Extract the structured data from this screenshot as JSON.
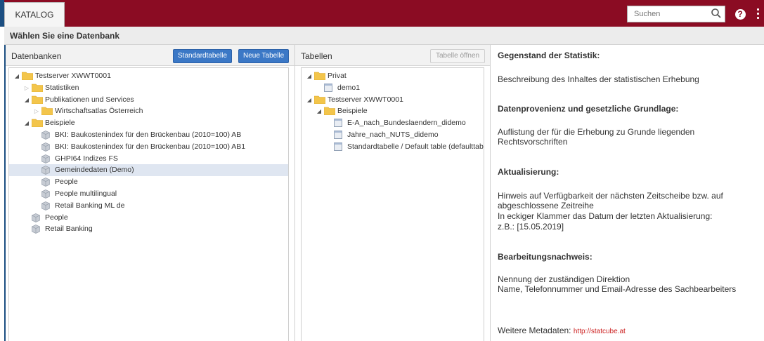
{
  "topbar": {
    "tab_label": "KATALOG",
    "search_placeholder": "Suchen",
    "help_label": "?",
    "brand_color": "#8b0c23"
  },
  "heading": "Wählen Sie eine Datenbank",
  "databases": {
    "title": "Datenbanken",
    "btn_standard": "Standardtabelle",
    "btn_new": "Neue Tabelle",
    "tree": [
      {
        "label": "Testserver XWWT0001",
        "icon": "folder-icon",
        "state": "open"
      },
      {
        "label": "Statistiken",
        "icon": "folder-icon",
        "state": "closed"
      },
      {
        "label": "Publikationen und Services",
        "icon": "folder-icon",
        "state": "open"
      },
      {
        "label": "Wirtschaftsatlas Österreich",
        "icon": "folder-icon",
        "state": "closed"
      },
      {
        "label": "Beispiele",
        "icon": "folder-icon",
        "state": "open"
      },
      {
        "label": "BKI: Baukostenindex für den Brückenbau (2010=100) AB",
        "icon": "cube-icon",
        "state": "leaf"
      },
      {
        "label": "BKI: Baukostenindex für den Brückenbau (2010=100) AB1",
        "icon": "cube-icon",
        "state": "leaf"
      },
      {
        "label": "GHPI64 Indizes FS",
        "icon": "cube-icon",
        "state": "leaf"
      },
      {
        "label": "Gemeindedaten (Demo)",
        "icon": "cube-icon",
        "state": "leaf",
        "selected": true
      },
      {
        "label": "People",
        "icon": "cube-icon",
        "state": "leaf"
      },
      {
        "label": "People multilingual",
        "icon": "cube-icon",
        "state": "leaf"
      },
      {
        "label": "Retail Banking ML de",
        "icon": "cube-icon",
        "state": "leaf"
      },
      {
        "label": "People",
        "icon": "cube-icon",
        "state": "leaf"
      },
      {
        "label": "Retail Banking",
        "icon": "cube-icon",
        "state": "leaf"
      }
    ]
  },
  "tables": {
    "title": "Tabellen",
    "btn_open": "Tabelle öffnen",
    "tree": [
      {
        "label": "Privat",
        "icon": "folder-icon",
        "state": "open"
      },
      {
        "label": "demo1",
        "icon": "table-icon",
        "state": "leaf"
      },
      {
        "label": "Testserver XWWT0001",
        "icon": "folder-icon",
        "state": "open"
      },
      {
        "label": "Beispiele",
        "icon": "folder-icon",
        "state": "open"
      },
      {
        "label": "E-A_nach_Bundeslaendern_didemo",
        "icon": "table-icon",
        "state": "leaf"
      },
      {
        "label": "Jahre_nach_NUTS_didemo",
        "icon": "table-icon",
        "state": "leaf"
      },
      {
        "label": "Standardtabelle / Default table (defaulttable)",
        "icon": "table-icon",
        "state": "leaf"
      }
    ]
  },
  "metadata": {
    "h_subject": "Gegenstand der Statistik:",
    "t_subject": "Beschreibung des Inhaltes der statistischen Erhebung",
    "h_provenance": "Datenprovenienz und gesetzliche Grundlage:",
    "t_provenance_1": "Auflistung der für die Erhebung zu Grunde liegenden",
    "t_provenance_2": "Rechtsvorschriften",
    "h_update": "Aktualisierung:",
    "t_update_1": "Hinweis auf Verfügbarkeit der nächsten Zeitscheibe bzw. auf",
    "t_update_2": "abgeschlossene Zeitreihe",
    "t_update_3": "In eckiger Klammer das Datum der letzten Aktualisierung:",
    "t_update_4": "z.B.: [15.05.2019]",
    "h_processing": "Bearbeitungsnachweis:",
    "t_processing_1": "Nennung der zuständigen Direktion",
    "t_processing_2": "Name, Telefonnummer und Email-Adresse des Sachbearbeiters",
    "more_label": "Weitere Metadaten:",
    "more_link": "http://statcube.at"
  }
}
